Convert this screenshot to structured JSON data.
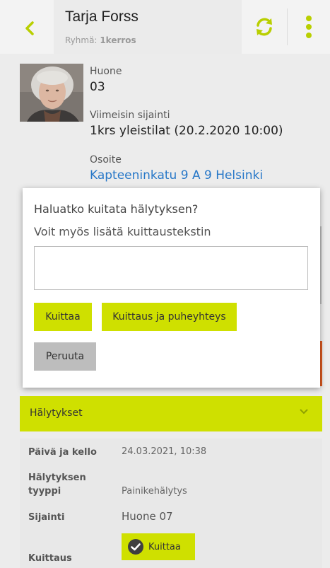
{
  "header": {
    "name": "Tarja Forss",
    "group_label": "Ryhmä:",
    "group_value": "1kerros"
  },
  "resident": {
    "room_label": "Huone",
    "room_value": "03",
    "location_label": "Viimeisin sijainti",
    "location_value": "1krs yleistilat (20.2.2020 10:00)",
    "address_label": "Osoite",
    "address_value": "Kapteeninkatu 9 A 9 Helsinki"
  },
  "dialog": {
    "title": "Haluatko kuitata hälytyksen?",
    "subtitle": "Voit myös lisätä kuittaustekstin",
    "textarea_value": "",
    "acknowledge_label": "Kuittaa",
    "acknowledge_call_label": "Kuittaus ja puheyhteys",
    "cancel_label": "Peruuta"
  },
  "alerts_section": {
    "title": "Hälytykset"
  },
  "alert": {
    "datetime_label": "Päivä ja kello",
    "datetime_value": "24.03.2021, 10:38",
    "type_label_line1": "Hälytyksen",
    "type_label_line2": "tyyppi",
    "type_value": "Painikehälytys",
    "location_label": "Sijainti",
    "location_value": "Huone 07",
    "ack_label": "Kuittaus",
    "ack_button_label": "Kuittaa"
  },
  "colors": {
    "accent": "#cfe000",
    "link": "#2878c8",
    "warning": "#d9571f"
  }
}
